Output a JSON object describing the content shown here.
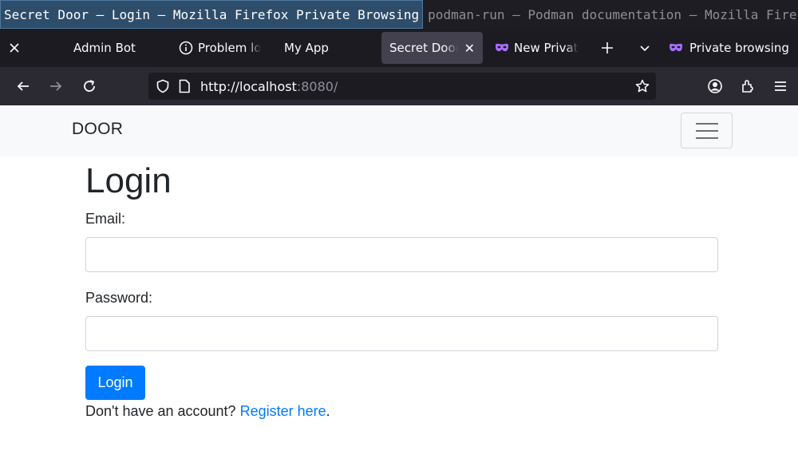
{
  "os_windows": [
    {
      "title": "Secret Door — Login — Mozilla Firefox Private Browsing",
      "active": true
    },
    {
      "title": "podman-run — Podman documentation — Mozilla Firefox",
      "active": false
    }
  ],
  "tabs": [
    {
      "label": "Admin Bot",
      "icon": "none",
      "selected": false
    },
    {
      "label": "Problem lo",
      "icon": "info-icon",
      "selected": false
    },
    {
      "label": "My App",
      "icon": "none",
      "selected": false
    },
    {
      "label": "Secret Door",
      "icon": "none",
      "selected": true
    },
    {
      "label": "New Privat",
      "icon": "private-mask-icon",
      "selected": false
    }
  ],
  "private_browsing_label": "Private browsing",
  "urlbar": {
    "host": "http://localhost",
    "rest": ":8080/"
  },
  "page": {
    "brand": "DOOR",
    "heading": "Login",
    "email_label": "Email:",
    "email_value": "",
    "password_label": "Password:",
    "password_value": "",
    "login_button": "Login",
    "register_prefix": "Don't have an account? ",
    "register_link": "Register here",
    "register_suffix": "."
  },
  "colors": {
    "primary": "#007bff",
    "navbar_bg": "#f8f9fa",
    "private_accent": "#a970ff"
  }
}
